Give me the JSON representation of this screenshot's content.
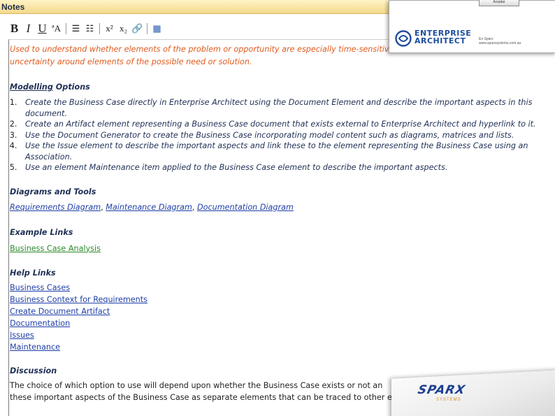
{
  "header": {
    "title": "Notes"
  },
  "toolbar": {
    "bold": "B",
    "italic": "I",
    "underline": "U",
    "font_color": "ªA",
    "bullet_list": "☰",
    "numbered_list": "☷",
    "superscript": "x²",
    "subscript": "x₂",
    "hyperlink": "🔗",
    "insert": "▦"
  },
  "note": {
    "intro_line1": "Used to understand whether elements of the problem or opportunity are especially time-sensitive, h",
    "intro_line2": "uncertainty around elements of the possible need or solution.",
    "modelling_word": "Modelling",
    "modelling_rest": " Options",
    "options": [
      "Create the Business Case directly in Enterprise Architect using the Document Element and describe the important aspects in this document.",
      "Create an Artifact element representing a Business Case document that exists external to Enterprise Architect and hyperlink to it.",
      "Use the Document Generator to create the Business Case incorporating model content such as diagrams, matrices and lists.",
      "Use the Issue element to describe the important aspects and link these to the element representing the Business Case using an Association.",
      "Use an element Maintenance item applied to the Business Case element to describe the important aspects."
    ],
    "diagrams_heading": "Diagrams and Tools",
    "diagram_links": [
      "Requirements Diagram",
      "Maintenance Diagram",
      "Documentation Diagram"
    ],
    "example_heading": "Example Links",
    "example_link": "Business Case Analysis",
    "help_heading": "Help Links",
    "help_links": [
      "Business Cases",
      "Business Context for Requirements",
      "Create Document Artifact",
      "Documentation",
      "Issues",
      "Maintenance"
    ],
    "discussion_heading": "Discussion",
    "discussion_line1": "The choice of which option to use will depend upon whether the Business Case exists or not  an",
    "discussion_line2": "these important aspects of the Business Case as separate elements that can be traced to other e"
  },
  "ea_card": {
    "button": "Aceptar",
    "brand_line1": "ENTERPRISE",
    "brand_line2": "ARCHITECT",
    "small_line1": "En Sparx",
    "small_line2": "www.sparxsystems.com.au"
  },
  "sparx_card": {
    "brand": "SPARX",
    "sub": "SYSTEMS"
  },
  "colors": {
    "intro": "#e05a1e",
    "link": "#1f3fa6",
    "green_link": "#2e8b2e",
    "heading": "#1f2f55",
    "header_bg": "#f4d98b"
  }
}
